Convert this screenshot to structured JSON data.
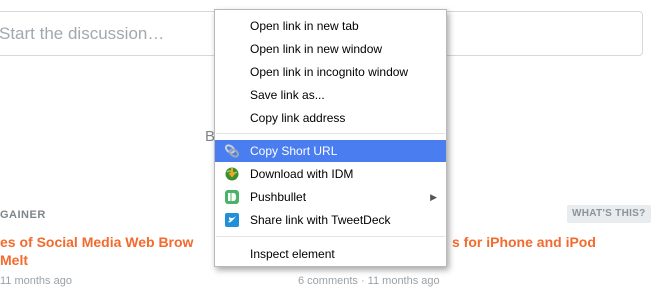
{
  "discussion": {
    "placeholder": "Start the discussion…"
  },
  "partial_heading": "B",
  "recommendations": {
    "kicker_left": "GAINER",
    "whats_this": "WHAT'S THIS?",
    "left_title_line1": "es of Social Media Web Brow",
    "left_title_line2": "Melt",
    "left_meta": "11 months ago",
    "right_title": "s for iPhone and iPod",
    "right_meta": "6 comments · 11 months ago"
  },
  "context_menu": {
    "items": [
      {
        "label": "Open link in new tab"
      },
      {
        "label": "Open link in new window"
      },
      {
        "label": "Open link in incognito window"
      },
      {
        "label": "Save link as..."
      },
      {
        "label": "Copy link address"
      },
      {
        "label": "Copy Short URL",
        "icon": "link-shortener-icon",
        "highlighted": true
      },
      {
        "label": "Download with IDM",
        "icon": "idm-globe-icon"
      },
      {
        "label": "Pushbullet",
        "icon": "pushbullet-icon",
        "has_submenu": true
      },
      {
        "label": "Share link with TweetDeck",
        "icon": "tweetdeck-icon"
      },
      {
        "label": "Inspect element"
      }
    ]
  },
  "colors": {
    "accent_link": "#f36a2c",
    "menu_highlight": "#4a7ef0"
  }
}
